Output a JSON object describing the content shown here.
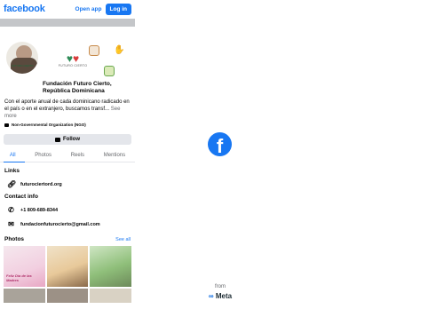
{
  "topbar": {
    "brand": "facebook",
    "open_app_label": "Open app",
    "login_label": "Log in"
  },
  "profile": {
    "name": "Fundación Futuro Cierto, República Dominicana",
    "about_text": "Con el aporte anual de cada dominicano radicado en el país o en el extranjero, buscamos transf...",
    "see_more": "See more",
    "category": "Non-Governmental Organization (NGO)",
    "follow_label": "Follow",
    "logo_text": "FUTURO CIERTO",
    "avatar_caption": "FUTURO CIERTO"
  },
  "tabs": [
    {
      "label": "All",
      "active": true
    },
    {
      "label": "Photos",
      "active": false
    },
    {
      "label": "Reels",
      "active": false
    },
    {
      "label": "Mentions",
      "active": false
    }
  ],
  "links": {
    "title": "Links",
    "items": [
      {
        "icon": "link-icon",
        "text": "futurociertord.org"
      }
    ]
  },
  "contact": {
    "title": "Contact info",
    "items": [
      {
        "icon": "phone-icon",
        "text": "+1 809-689-8344"
      },
      {
        "icon": "mail-icon",
        "text": "fundacionfuturocierto@gmail.com"
      }
    ]
  },
  "photos": {
    "title": "Photos",
    "see_all": "See all",
    "first_caption": "Feliz Día de las Madres"
  },
  "splash": {
    "from_label": "from",
    "meta_label": "Meta"
  },
  "colors": {
    "brand_blue": "#1877f2",
    "page_bg": "#ffffff",
    "button_gray": "#e4e6eb"
  }
}
